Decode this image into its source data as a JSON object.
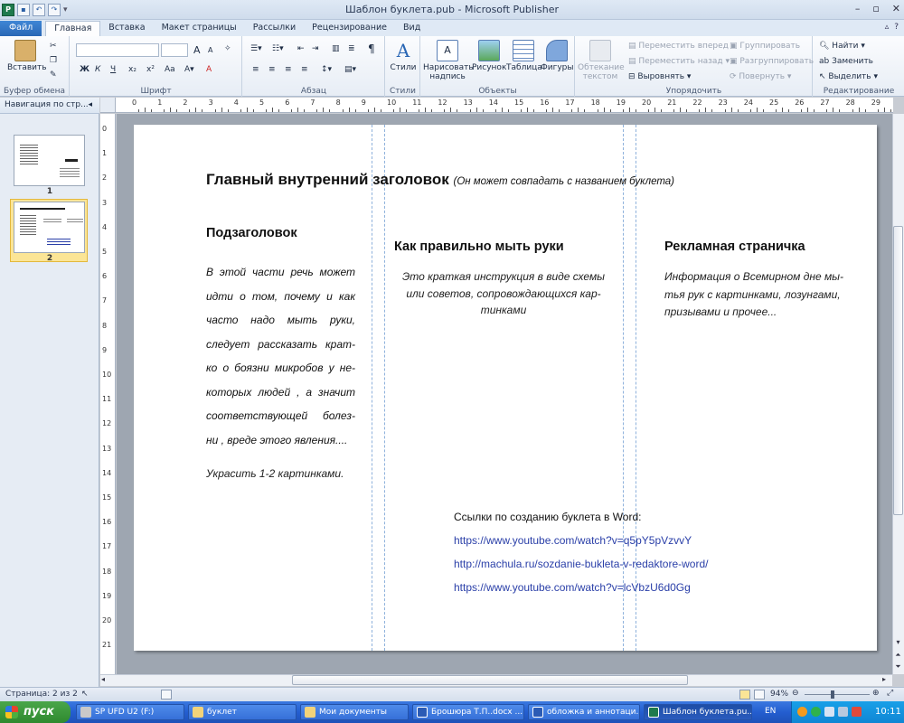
{
  "window": {
    "title": "Шаблон буклета.pub - Microsoft Publisher"
  },
  "tabs": [
    {
      "label": "Файл"
    },
    {
      "label": "Главная"
    },
    {
      "label": "Вставка"
    },
    {
      "label": "Макет страницы"
    },
    {
      "label": "Рассылки"
    },
    {
      "label": "Рецензирование"
    },
    {
      "label": "Вид"
    }
  ],
  "ribbon": {
    "clipboard": {
      "paste": "Вставить",
      "group": "Буфер обмена"
    },
    "font": {
      "group": "Шрифт",
      "bold": "Ж",
      "italic": "К",
      "underline": "Ч",
      "sub": "x₂",
      "sup": "x²",
      "grow": "A",
      "shrink": "A",
      "case": "Aa",
      "color": "A"
    },
    "paragraph": {
      "group": "Абзац",
      "pilcrow": "¶"
    },
    "styles": {
      "label": "Стили",
      "group": "Стили"
    },
    "objects": {
      "group": "Объекты",
      "draw": "Нарисовать надпись",
      "picture": "Рисунок",
      "table": "Таблица",
      "shapes": "Фигуры"
    },
    "arrange": {
      "group": "Упорядочить",
      "wrap": "Обтекание текстом",
      "forward": "Переместить вперед",
      "backward": "Переместить назад",
      "align": "Выровнять",
      "group_btn": "Группировать",
      "ungroup": "Разгруппировать",
      "rotate": "Повернуть"
    },
    "editing": {
      "group": "Редактирование",
      "find": "Найти",
      "replace": "Заменить",
      "select": "Выделить"
    }
  },
  "nav": {
    "title": "Навигация по стр...",
    "pages": [
      {
        "num": "1"
      },
      {
        "num": "2"
      }
    ]
  },
  "hruler": [
    "0",
    "1",
    "2",
    "3",
    "4",
    "5",
    "6",
    "7",
    "8",
    "9",
    "10",
    "11",
    "12",
    "13",
    "14",
    "15",
    "16",
    "17",
    "18",
    "19",
    "20",
    "21",
    "22",
    "23",
    "24",
    "25",
    "26",
    "27",
    "28",
    "29"
  ],
  "vruler": [
    "0",
    "1",
    "2",
    "3",
    "4",
    "5",
    "6",
    "7",
    "8",
    "9",
    "10",
    "11",
    "12",
    "13",
    "14",
    "15",
    "16",
    "17",
    "18",
    "19",
    "20",
    "21"
  ],
  "page": {
    "main_title": "Главный внутренний заголовок",
    "main_title_note": "(Он может совпадать с названием буклета)",
    "col1_heading": "Подзаголовок",
    "col1_lines": [
      "В этой части речь может",
      "идти о том, почему и как",
      "часто надо мыть руки,",
      "следует рассказать крат-",
      "ко о боязни микробов у не-",
      "которых людей , а значит",
      "соответствующей болез-",
      "ни , вреде этого явления...."
    ],
    "col1_extra": "Украсить  1-2 картинками.",
    "col2_heading": "Как правильно мыть руки",
    "col2_lines": [
      "Это краткая инструкция в виде схемы",
      "или советов, сопровождающихся кар-",
      "тинками"
    ],
    "col3_heading": "Рекламная страничка",
    "col3_lines": [
      "Информация о Всемирном дне мы-",
      "тья рук  с картинками, лозунгами,",
      "призывами и прочее..."
    ],
    "links_label": "Ссылки по созданию буклета в  Word:",
    "links": [
      "https://www.youtube.com/watch?v=q5pY5pVzvvY",
      "http://machula.ru/sozdanie-bukleta-v-redaktore-word/",
      "https://www.youtube.com/watch?v=lcVbzU6d0Gg"
    ]
  },
  "status": {
    "page": "Страница: 2 из 2",
    "zoom": "94%"
  },
  "taskbar": {
    "start": "пуск",
    "tasks": [
      {
        "label": "SP UFD U2 (F:)"
      },
      {
        "label": "буклет"
      },
      {
        "label": "Мои документы"
      },
      {
        "label": "Брошюра Т.П..docx ..."
      },
      {
        "label": "обложка и аннотаци..."
      },
      {
        "label": "Шаблон буклета.pu..."
      }
    ],
    "lang": "EN",
    "time": "10:11"
  }
}
